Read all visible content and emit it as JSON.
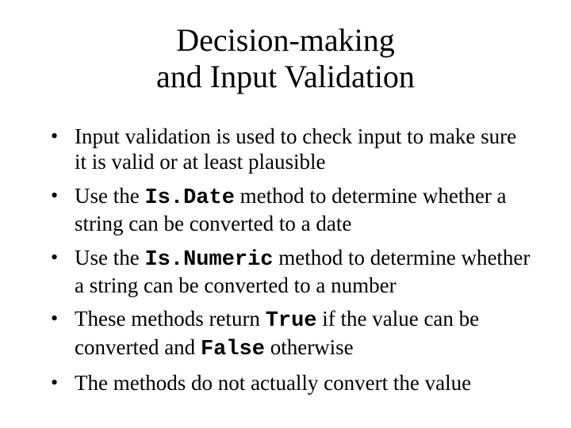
{
  "title_line1": "Decision-making",
  "title_line2": "and Input Validation",
  "bullets": {
    "b1": "Input validation is used to check input to make sure it is valid or at least plausible",
    "b2a": "Use the ",
    "b2code": "Is.Date",
    "b2b": " method to determine whether a string can be converted to a date",
    "b3a": "Use the ",
    "b3code": "Is.Numeric",
    "b3b": " method to determine whether a string can be converted to a number",
    "b4a": "These methods return ",
    "b4code1": "True",
    "b4b": " if the value can be converted and ",
    "b4code2": "False",
    "b4c": " otherwise",
    "b5": "The methods do not actually convert the value"
  }
}
